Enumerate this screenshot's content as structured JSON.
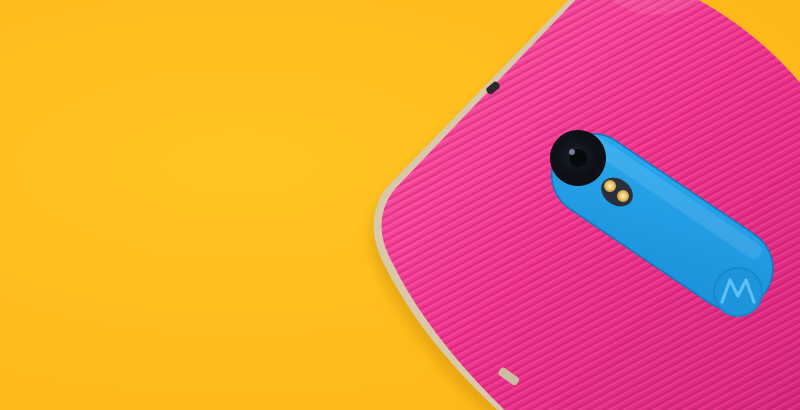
{
  "scene": {
    "subject": "phone-back",
    "colors": {
      "background": "#ffbe1c",
      "phone_body": "#f2348f",
      "phone_body_dark": "#c9206f",
      "phone_frame": "#d7c6a8",
      "camera_strip": "#1e9fe6",
      "camera_strip_light": "#38b6f5",
      "lens": "#1b1f2a",
      "flash": "#e9c46b",
      "button": "#cbbd9f"
    },
    "logo": {
      "kind": "motorola-batwing",
      "icon": "motorola-logo-icon"
    }
  }
}
